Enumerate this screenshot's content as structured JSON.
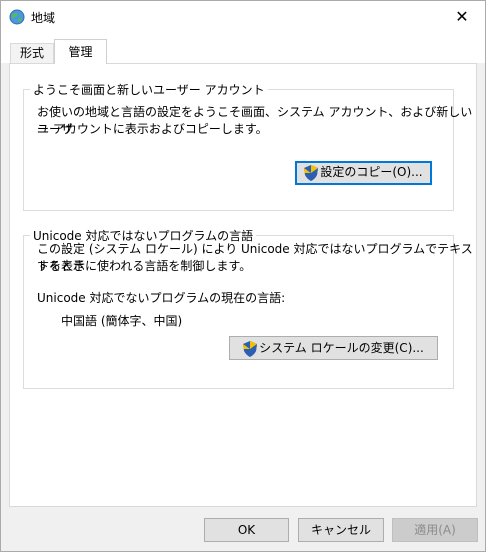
{
  "window": {
    "title": "地域",
    "close_glyph": "✕"
  },
  "tabs": [
    {
      "label": "形式",
      "selected": false
    },
    {
      "label": "管理",
      "selected": true
    }
  ],
  "welcome_group": {
    "legend": "ようこそ画面と新しいユーザー アカウント",
    "description_line1": "お使いの地域と言語の設定をようこそ画面、システム アカウント、および新しいユーザ",
    "description_line2": "ー アカウントに表示およびコピーします。",
    "copy_button_label": "設定のコピー(O)..."
  },
  "unicode_group": {
    "legend": "Unicode 対応ではないプログラムの言語",
    "description_line1": "この設定 (システム ロケール) により Unicode 対応ではないプログラムでテキストを表示",
    "description_line2": "するときに使われる言語を制御します。",
    "current_label": "Unicode 対応でないプログラムの現在の言語:",
    "current_value": "中国語 (簡体字、中国)",
    "change_button_label": "システム ロケールの変更(C)..."
  },
  "footer": {
    "ok_label": "OK",
    "cancel_label": "キャンセル",
    "apply_label": "適用(A)"
  },
  "icons": {
    "app": "globe-icon",
    "shield": "uac-shield-icon",
    "close": "close-icon"
  },
  "colors": {
    "focus_border": "#0078d7",
    "shield_blue": "#2b5fb4",
    "shield_yellow": "#f2c200"
  }
}
